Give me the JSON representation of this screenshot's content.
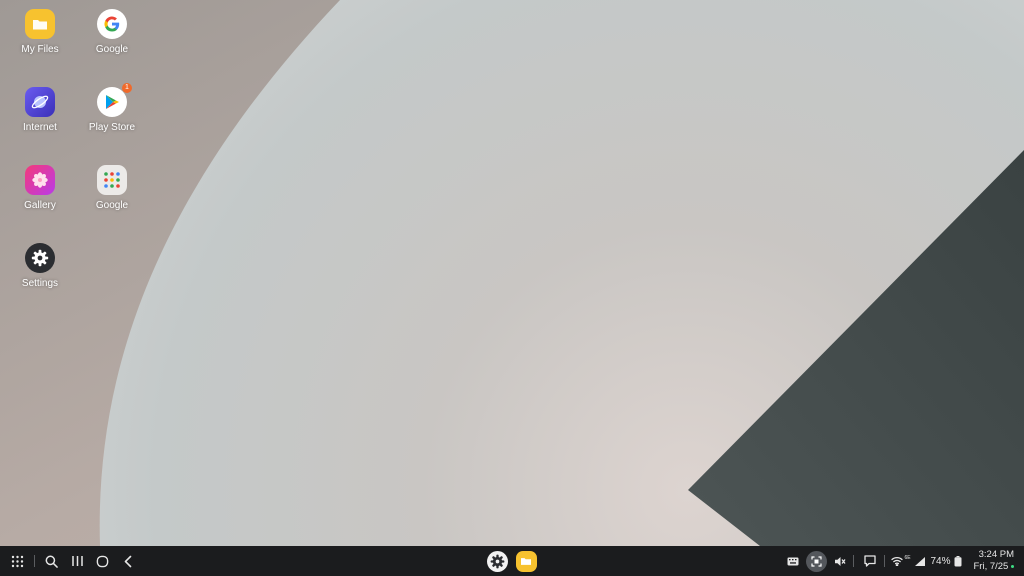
{
  "desktop": {
    "icons": [
      {
        "label": "My Files",
        "icon": "folder-icon"
      },
      {
        "label": "Google",
        "icon": "google-g-icon"
      },
      {
        "label": "Internet",
        "icon": "internet-browser-icon"
      },
      {
        "label": "Play Store",
        "icon": "play-store-icon",
        "badge": "1"
      },
      {
        "label": "Gallery",
        "icon": "gallery-flower-icon"
      },
      {
        "label": "Google",
        "icon": "google-apps-folder-icon"
      },
      {
        "label": "Settings",
        "icon": "gear-icon"
      }
    ]
  },
  "taskbar": {
    "left": [
      "apps-grid-icon",
      "search-icon",
      "recents-icon",
      "home-icon",
      "back-icon"
    ],
    "pinned": [
      "settings-gear-icon",
      "folder-icon"
    ],
    "tray": {
      "icons": [
        "keyboard-icon",
        "screen-capture-icon",
        "mute-icon",
        "chat-icon",
        "wifi-icon",
        "signal-icon",
        "battery-icon"
      ],
      "wifi_label": "6E",
      "battery": "74%"
    },
    "clock": {
      "time": "3:24 PM",
      "date": "Fri, 7/25"
    }
  },
  "colors": {
    "taskbar_bg": "#1b1c1e",
    "wallpaper_light": "#c6cbcb",
    "wallpaper_dark": "#333b3b",
    "wallpaper_left": "#a49c97"
  }
}
